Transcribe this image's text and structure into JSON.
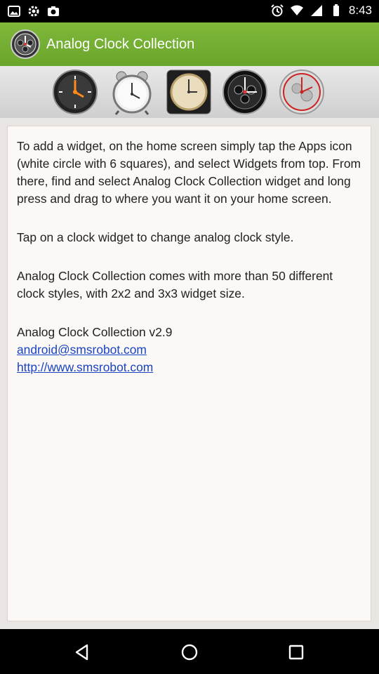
{
  "status": {
    "time": "8:43",
    "left_icons": [
      "photo-icon",
      "settings-icon",
      "camera-icon"
    ],
    "right_icons": [
      "alarm-icon",
      "wifi-icon",
      "signal-icon",
      "battery-icon"
    ]
  },
  "app": {
    "title": "Analog Clock Collection",
    "accent_color": "#6aa52b"
  },
  "clock_styles": [
    {
      "name": "clock-style-1-icon"
    },
    {
      "name": "clock-style-2-icon"
    },
    {
      "name": "clock-style-3-icon"
    },
    {
      "name": "clock-style-4-icon"
    },
    {
      "name": "clock-style-5-icon"
    }
  ],
  "content": {
    "para1": "To add a widget, on the home screen simply tap the Apps icon (white circle with 6 squares), and select Widgets from top. From there, find and select Analog Clock Collection widget and long press and drag to where you want it on your home screen.",
    "para2": "Tap on a clock widget to change analog clock style.",
    "para3": "Analog Clock Collection comes with more than 50 different clock styles, with 2x2 and 3x3 widget size.",
    "version": "Analog Clock Collection v2.9",
    "email": "android@smsrobot.com",
    "website": "http://www.smsrobot.com",
    "link_color": "#1a44c2"
  },
  "navigation": {
    "back": "back-icon",
    "home": "home-icon",
    "recents": "recents-icon"
  }
}
